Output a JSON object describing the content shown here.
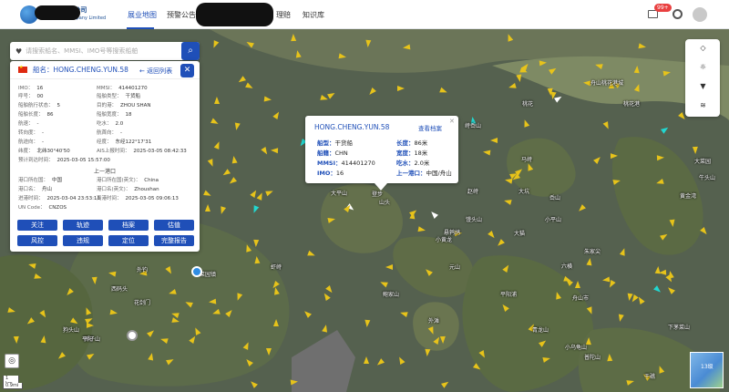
{
  "header": {
    "company_name": "**股份有限公司",
    "company_sub": "Insurance Company Limited",
    "nav": [
      "展业地图",
      "预警公告",
      "理赔",
      "知识库"
    ],
    "active_nav": "展业地图",
    "mail_badge": "99+"
  },
  "search": {
    "placeholder": "请搜索船名、MMSI、IMO号等搜索船舶"
  },
  "info": {
    "ship_label": "船名：",
    "ship_name": "HONG.CHENG.YUN.58",
    "back": "返回列表",
    "fields": [
      {
        "label": "IMO：",
        "value": "16"
      },
      {
        "label": "MMSI：",
        "value": "414401270"
      },
      {
        "label": "呼号：",
        "value": "00"
      },
      {
        "label": "船舶类型：",
        "value": "干货船"
      },
      {
        "label": "船舶航行状态：",
        "value": "5"
      },
      {
        "label": "目的港：",
        "value": "ZHOU SHAN"
      },
      {
        "label": "船舶长度：",
        "value": "86"
      },
      {
        "label": "船舶宽度：",
        "value": "18"
      },
      {
        "label": "航速：",
        "value": "-"
      },
      {
        "label": "吃水：",
        "value": "2.0"
      },
      {
        "label": "转向度：",
        "value": "-"
      },
      {
        "label": "航首向：",
        "value": "-"
      },
      {
        "label": "航迹向：",
        "value": "-"
      },
      {
        "label": "经度：",
        "value": "东经122°17'31"
      },
      {
        "label": "纬度：",
        "value": "北纬30°40'50"
      },
      {
        "label": "AIS上报时间：",
        "value": "2025-03-05 08:42:33"
      },
      {
        "label": "预计到达时间：",
        "value": "2025-03-05 15:57:00"
      }
    ],
    "section_title": "上一港口",
    "port_fields": [
      {
        "label": "港口所在国：",
        "value": "中国"
      },
      {
        "label": "港口所在国(英文)：",
        "value": "China"
      },
      {
        "label": "港口名：",
        "value": "舟山"
      },
      {
        "label": "港口名(英文)：",
        "value": "Zhoushan"
      },
      {
        "label": "进港时间：",
        "value": "2025-03-04 23:53:11"
      },
      {
        "label": "离港时间：",
        "value": "2025-03-05 09:06:13"
      },
      {
        "label": "UN Code：",
        "value": "CNZOS"
      }
    ],
    "buttons": [
      "关注",
      "轨迹",
      "档案",
      "估值",
      "风控",
      "违规",
      "定位",
      "完整报告"
    ]
  },
  "popup": {
    "name": "HONG.CHENG.YUN.58",
    "link": "查看档案",
    "fields": [
      {
        "label": "船型：",
        "value": "干货船"
      },
      {
        "label": "长度：",
        "value": "86米"
      },
      {
        "label": "船籍：",
        "value": "CHN"
      },
      {
        "label": "宽度：",
        "value": "18米"
      },
      {
        "label": "MMSI：",
        "value": "414401270"
      },
      {
        "label": "吃水：",
        "value": "2.0米"
      },
      {
        "label": "IMO：",
        "value": "16"
      },
      {
        "label": "上一港口：",
        "value": "中国/舟山"
      }
    ]
  },
  "map": {
    "places": [
      "舟山桃花港城",
      "桃花",
      "桃花港",
      "峙岙山",
      "登步",
      "马峙",
      "大坑",
      "赵峙",
      "山头",
      "大平山",
      "小平山",
      "馒头山",
      "悬鹁鸪",
      "大猫",
      "朱家尖",
      "虾峙",
      "六横",
      "元山",
      "菜园镇",
      "外钓",
      "鲍家山",
      "平阳浦",
      "舟山市",
      "外滩",
      "狗头山",
      "狮子山",
      "青龙山",
      "小乌龟山",
      "普陀山",
      "干礁",
      "黄金湾",
      "牛头山",
      "大菜园",
      "下茅菜山",
      "花剑门",
      "平阳",
      "西码头",
      "岙山",
      "小黄龙"
    ],
    "scale_km": "1 km",
    "scale_mi": "0.9mi",
    "zoom": "13级"
  }
}
